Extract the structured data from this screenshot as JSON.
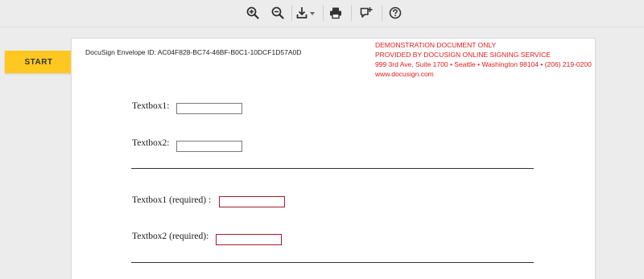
{
  "toolbar": {
    "buttons": [
      {
        "icon": "zoom-in-icon"
      },
      {
        "icon": "zoom-out-icon"
      },
      {
        "icon": "download-icon"
      },
      {
        "icon": "print-icon"
      },
      {
        "icon": "comment-add-icon"
      },
      {
        "icon": "help-icon"
      }
    ]
  },
  "start_button": {
    "label": "START",
    "color": "#ffc820"
  },
  "document": {
    "envelope_id": "DocuSign Envelope ID: AC04F828-BC74-46BF-B0C1-10DCF1D57A0D",
    "demo_notice": {
      "line1": "DEMONSTRATION DOCUMENT ONLY",
      "line2": "PROVIDED BY DOCUSIGN ONLINE SIGNING SERVICE",
      "line3": "999 3rd Ave, Suite 1700  • Seattle • Washington 98104 • (206) 219-0200",
      "line4": "www.docusign.com",
      "color": "#e21c1c"
    },
    "fields": {
      "textbox1_label": "Textbox1:",
      "textbox2_label": "Textbox2:",
      "textbox1_required_label": "Textbox1 (required) :",
      "textbox2_required_label": "Textbox2 (required):",
      "textbox1_value": "",
      "textbox2_value": "",
      "textbox1_required_value": "",
      "textbox2_required_value": "",
      "required_border_color": "#a31c2c"
    }
  }
}
